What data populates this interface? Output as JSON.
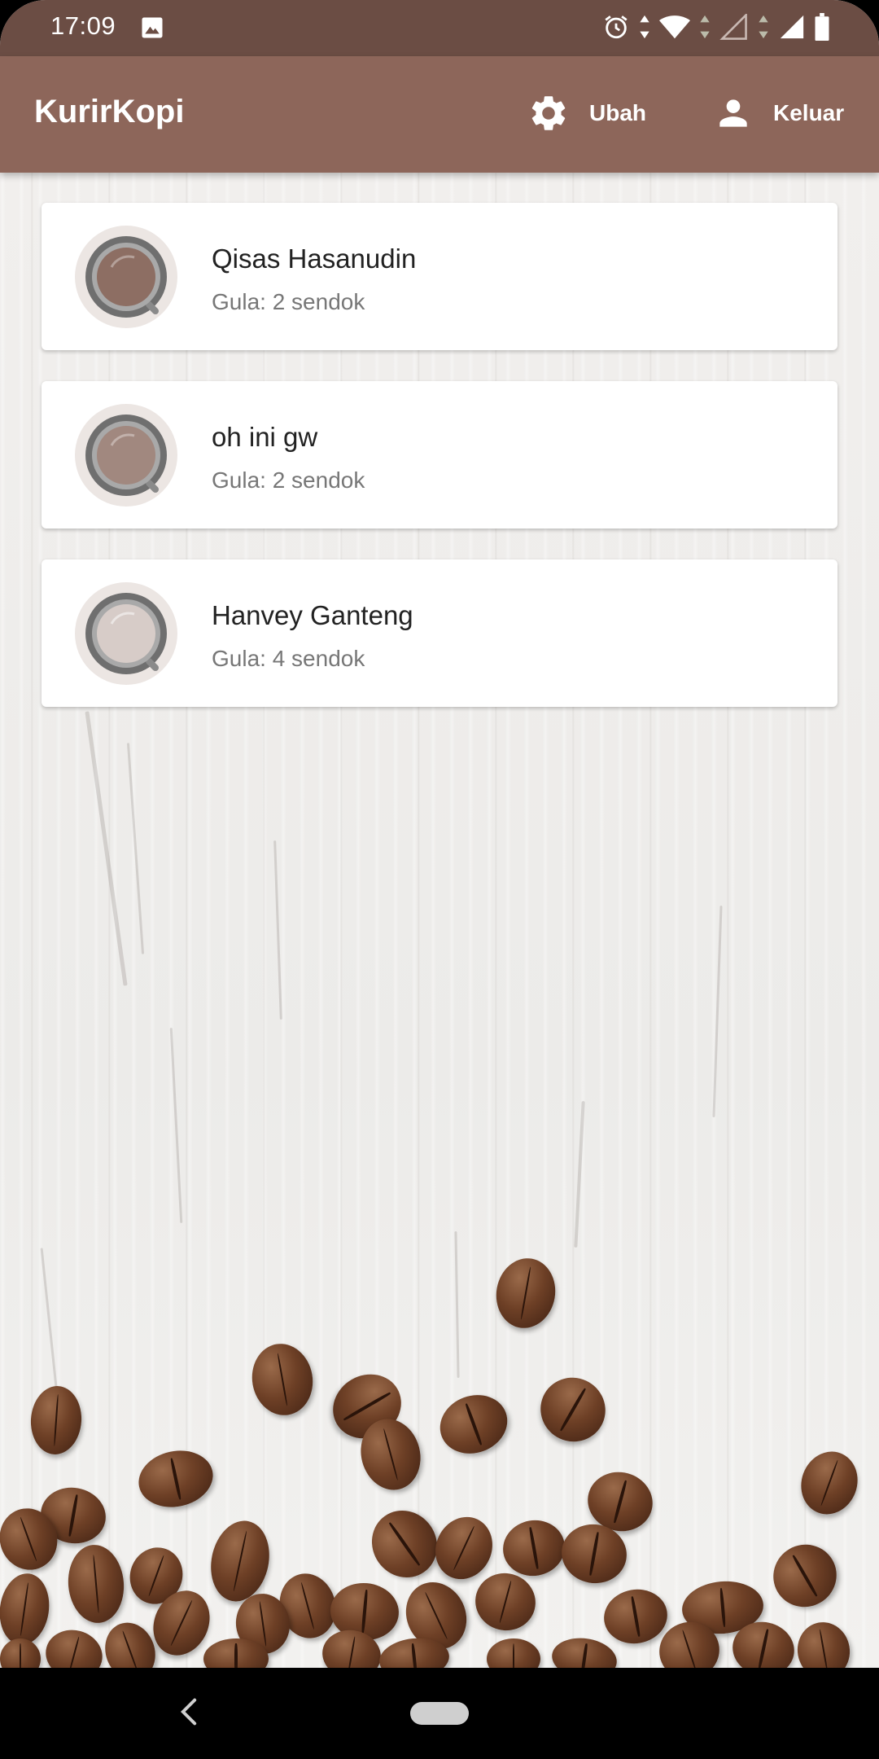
{
  "status_bar": {
    "time": "17:09",
    "icons": [
      "image-icon",
      "alarm-icon",
      "data-arrows-icon",
      "wifi-icon",
      "signal-empty-icon",
      "signal-full-icon",
      "battery-icon"
    ]
  },
  "app_bar": {
    "title": "KurirKopi",
    "actions": [
      {
        "label": "Ubah",
        "icon": "gear-icon"
      },
      {
        "label": "Keluar",
        "icon": "person-icon"
      }
    ]
  },
  "orders": [
    {
      "name": "Qisas Hasanudin",
      "sugar": "Gula: 2 sendok",
      "icon": "coffee-cup-icon",
      "coffee_color": "#8d6e63"
    },
    {
      "name": "oh ini gw",
      "sugar": "Gula: 2 sendok",
      "icon": "coffee-cup-icon",
      "coffee_color": "#a1887f"
    },
    {
      "name": "Hanvey Ganteng",
      "sugar": "Gula: 4 sendok",
      "icon": "coffee-cup-icon",
      "coffee_color": "#d7ccc8"
    }
  ],
  "colors": {
    "app_bar": "#8d665a",
    "status_bar": "#6b4d44",
    "card": "#ffffff"
  },
  "nav_bar": {
    "icons": [
      "back-icon",
      "home-pill-icon"
    ]
  }
}
